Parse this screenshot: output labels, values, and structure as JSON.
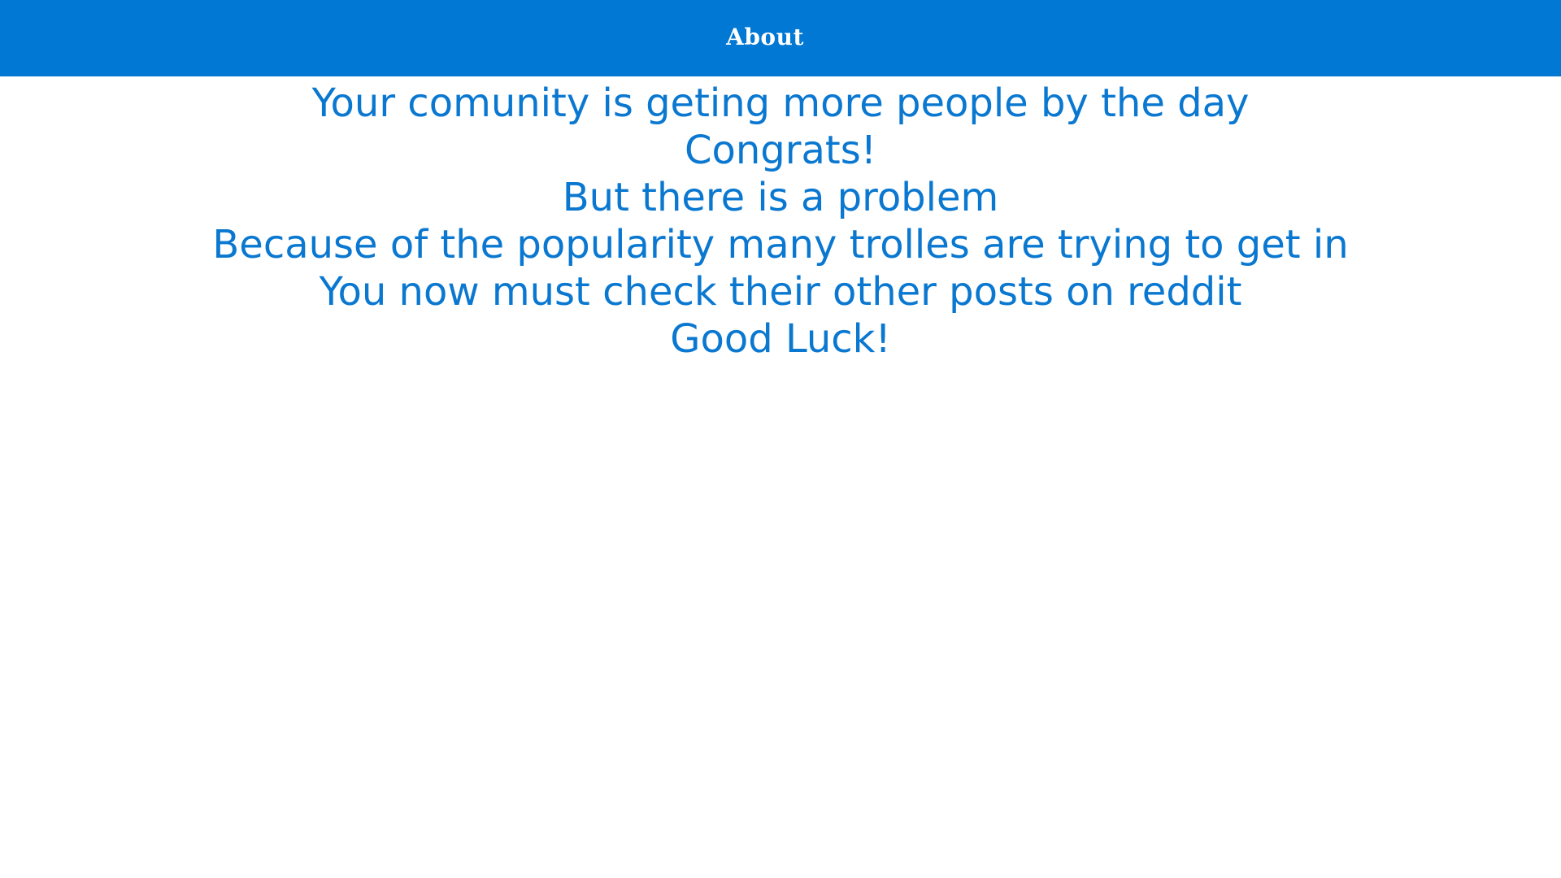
{
  "header": {
    "title": "About"
  },
  "about": {
    "lines": [
      "Your comunity is geting more people by the day",
      "Congrats!",
      "But there is a problem",
      "Because of the popularity many trolles are trying to get in",
      "You now must check their other posts on reddit",
      "Good Luck!"
    ]
  },
  "colors": {
    "header_background": "#0078d4",
    "header_text": "#ffffff",
    "body_text": "#0a78d0",
    "page_background": "#ffffff"
  }
}
